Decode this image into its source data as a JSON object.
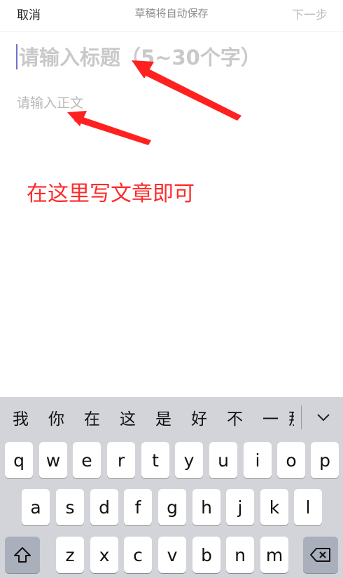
{
  "topbar": {
    "cancel": "取消",
    "draft_status": "草稿将自动保存",
    "next": "下一步"
  },
  "editor": {
    "title_placeholder": "请输入标题（5~30个字）",
    "body_placeholder": "请输入正文"
  },
  "annotation": {
    "text": "在这里写文章即可",
    "color": "#ff2a2a"
  },
  "keyboard": {
    "candidates": [
      "我",
      "你",
      "在",
      "这",
      "是",
      "好",
      "不",
      "一",
      "那"
    ],
    "row1": [
      "q",
      "w",
      "e",
      "r",
      "t",
      "y",
      "u",
      "i",
      "o",
      "p"
    ],
    "row2": [
      "a",
      "s",
      "d",
      "f",
      "g",
      "h",
      "j",
      "k",
      "l"
    ],
    "row3": [
      "z",
      "x",
      "c",
      "v",
      "b",
      "n",
      "m"
    ],
    "shift_icon": "shift-arrow-icon",
    "delete_icon": "backspace-icon",
    "collapse_icon": "chevron-down-icon"
  }
}
